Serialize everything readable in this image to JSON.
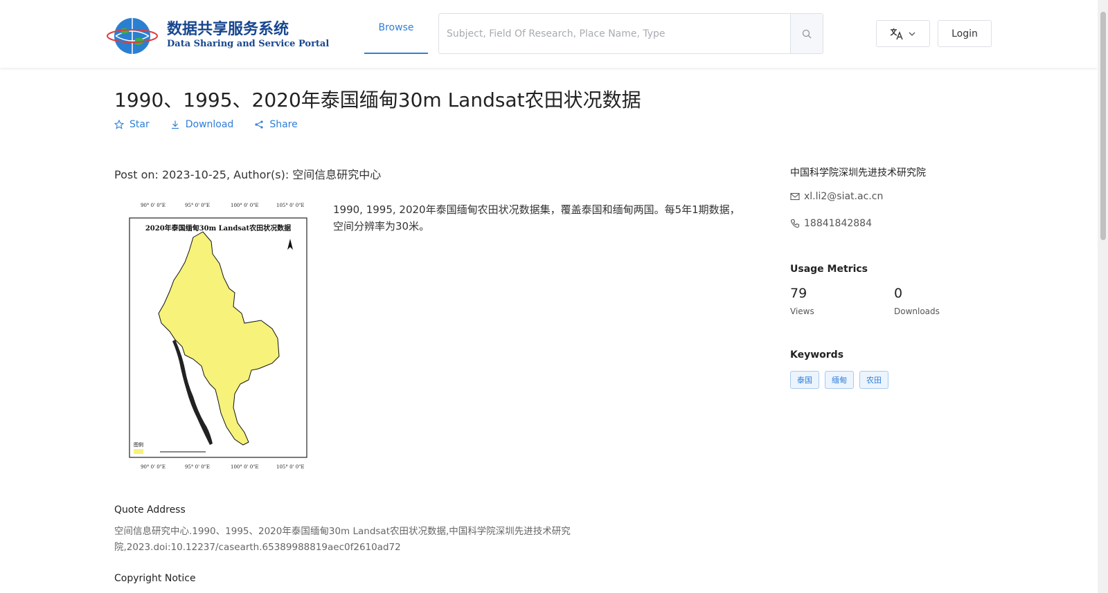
{
  "header": {
    "logo_cn": "数据共享服务系统",
    "logo_en": "Data Sharing and Service Portal",
    "nav_browse": "Browse",
    "search_placeholder": "Subject, Field Of Research, Place Name, Type",
    "login": "Login"
  },
  "dataset": {
    "title": "1990、1995、2020年泰国缅甸30m Landsat农田状况数据",
    "actions": {
      "star": "Star",
      "download": "Download",
      "share": "Share"
    },
    "post_line": "Post on: 2023-10-25, Author(s): 空间信息研究中心",
    "description": "1990, 1995, 2020年泰国缅甸农田状况数据集，覆盖泰国和缅甸两国。每5年1期数据，空间分辨率为30米。",
    "thumbnail_title": "2020年泰国缅甸30m Landsat农田状况数据"
  },
  "sidebar": {
    "org": "中国科学院深圳先进技术研究院",
    "email": "xl.li2@siat.ac.cn",
    "phone": "18841842884",
    "metrics_title": "Usage Metrics",
    "views_value": "79",
    "views_label": "Views",
    "downloads_value": "0",
    "downloads_label": "Downloads",
    "keywords_title": "Keywords",
    "keywords": [
      "泰国",
      "缅甸",
      "农田"
    ]
  },
  "quote": {
    "title": "Quote Address",
    "body": "空间信息研究中心.1990、1995、2020年泰国缅甸30m Landsat农田状况数据,中国科学院深圳先进技术研究院,2023.doi:10.12237/casearth.65389988819aec0f2610ad72"
  },
  "copyright": {
    "title": "Copyright Notice"
  },
  "colors": {
    "accent": "#2f7ed8",
    "logo_blue": "#17468f",
    "crop_yellow": "#f6f27a"
  }
}
